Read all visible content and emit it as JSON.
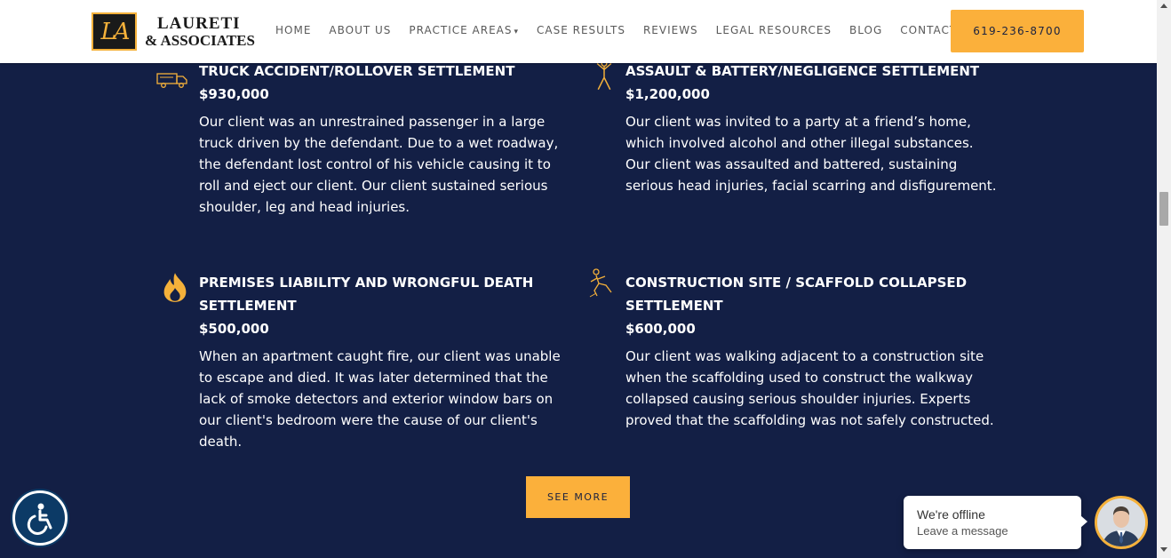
{
  "header": {
    "logo": {
      "mark": "LA",
      "line1": "LAURETI",
      "line2": "& ASSOCIATES"
    },
    "nav": [
      {
        "label": "HOME"
      },
      {
        "label": "ABOUT US"
      },
      {
        "label": "PRACTICE AREAS",
        "has_dropdown": true
      },
      {
        "label": "CASE RESULTS"
      },
      {
        "label": "REVIEWS"
      },
      {
        "label": "LEGAL RESOURCES"
      },
      {
        "label": "BLOG"
      },
      {
        "label": "CONTACT"
      }
    ],
    "phone": "619-236-8700"
  },
  "results": [
    {
      "icon": "truck-icon",
      "title": "TRUCK ACCIDENT/ROLLOVER SETTLEMENT",
      "amount": "$930,000",
      "description": "Our client was an unrestrained passenger in a large truck driven by the defendant. Due to a wet roadway, the defendant lost control of his vehicle causing it to roll and eject our client. Our client sustained serious shoulder, leg and head injuries."
    },
    {
      "icon": "assault-icon",
      "title": "ASSAULT & BATTERY/NEGLIGENCE SETTLEMENT",
      "amount": "$1,200,000",
      "description": "Our client was invited to a party at a friend’s home, which involved alcohol and other illegal substances. Our client was assaulted and battered, sustaining serious head injuries, facial scarring and disfigurement."
    },
    {
      "icon": "fire-icon",
      "title": "PREMISES LIABILITY AND WRONGFUL DEATH SETTLEMENT",
      "amount": "$500,000",
      "description": "When an apartment caught fire, our client was unable to escape and died. It was later determined that the lack of smoke detectors and exterior window bars on our client's bedroom were the cause of our client's death."
    },
    {
      "icon": "falling-person-icon",
      "title": "CONSTRUCTION SITE / SCAFFOLD COLLAPSED SETTLEMENT",
      "amount": "$600,000",
      "description": "Our client was walking adjacent to a construction site when the scaffolding used to construct the walkway collapsed causing serious shoulder injuries. Experts proved that the scaffolding was not safely constructed."
    }
  ],
  "see_more": "SEE MORE",
  "chat": {
    "status": "We're offline",
    "subtitle": "Leave a message"
  },
  "colors": {
    "navy": "#131f45",
    "accent": "#fbb03b",
    "white": "#ffffff"
  }
}
